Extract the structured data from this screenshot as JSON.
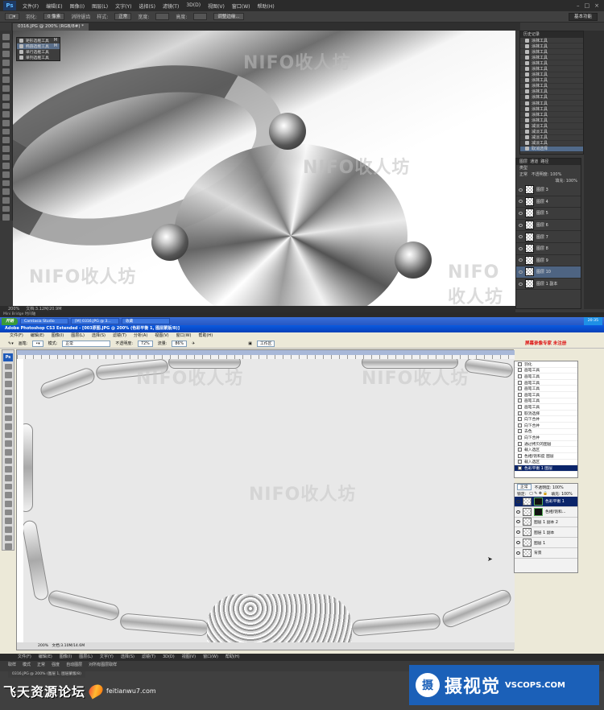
{
  "top": {
    "logo": "Ps",
    "menus": [
      "文件(F)",
      "编辑(E)",
      "图像(I)",
      "图层(L)",
      "文字(Y)",
      "选择(S)",
      "滤镜(T)",
      "3D(D)",
      "视图(V)",
      "窗口(W)",
      "帮助(H)"
    ],
    "options": {
      "feather_label": "羽化:",
      "feather_value": "0 像素",
      "antialias": "消除锯齿",
      "style_label": "样式:",
      "style_value": "正常",
      "width_label": "宽度:",
      "height_label": "高度:",
      "refine_edge": "调整边缘..."
    },
    "workspace": "基本功能",
    "doc_tab": "0316.JPG @ 200% (RGB/8#) *",
    "status": "200%",
    "doc_info": "文档:3.12M/20.9M",
    "mini_bridge": "Mini Bridge   时间轴",
    "history_title": "历史记录",
    "history": [
      {
        "label": "涂抹工具",
        "sel": false
      },
      {
        "label": "涂抹工具",
        "sel": false
      },
      {
        "label": "涂抹工具",
        "sel": false
      },
      {
        "label": "涂抹工具",
        "sel": false
      },
      {
        "label": "涂抹工具",
        "sel": false
      },
      {
        "label": "涂抹工具",
        "sel": false
      },
      {
        "label": "涂抹工具",
        "sel": false
      },
      {
        "label": "涂抹工具",
        "sel": false
      },
      {
        "label": "涂抹工具",
        "sel": false
      },
      {
        "label": "涂抹工具",
        "sel": false
      },
      {
        "label": "涂抹工具",
        "sel": false
      },
      {
        "label": "涂抹工具",
        "sel": false
      },
      {
        "label": "涂抹工具",
        "sel": false
      },
      {
        "label": "涂抹工具",
        "sel": false
      },
      {
        "label": "涂抹工具",
        "sel": false
      },
      {
        "label": "减淡工具",
        "sel": false
      },
      {
        "label": "减淡工具",
        "sel": false
      },
      {
        "label": "减淡工具",
        "sel": false
      },
      {
        "label": "减淡工具",
        "sel": false
      },
      {
        "label": "取消选择",
        "sel": true
      }
    ],
    "layers_tabs": [
      "图层",
      "通道",
      "路径"
    ],
    "layers_kind": "类型",
    "layers_mode": "正常",
    "layers_opacity": "不透明度: 100%",
    "layers_fill": "填充: 100%",
    "layers": [
      {
        "label": "图层 3",
        "sel": false
      },
      {
        "label": "图层 4",
        "sel": false
      },
      {
        "label": "图层 5",
        "sel": false
      },
      {
        "label": "图层 6",
        "sel": false
      },
      {
        "label": "图层 7",
        "sel": false
      },
      {
        "label": "图层 8",
        "sel": false
      },
      {
        "label": "图层 9",
        "sel": false
      },
      {
        "label": "图层 10",
        "sel": true
      },
      {
        "label": "图层 1 副本",
        "sel": false
      }
    ],
    "flyout": [
      {
        "label": "矩形选框工具",
        "key": "M",
        "sel": false
      },
      {
        "label": "椭圆选框工具",
        "key": "M",
        "sel": true
      },
      {
        "label": "单行选框工具",
        "key": "",
        "sel": false
      },
      {
        "label": "单列选框工具",
        "key": "",
        "sel": false
      }
    ]
  },
  "bottom": {
    "taskbar": {
      "start": "开始",
      "tasks": [
        "Camtasia Studio",
        "[M] 0316.JPG @ 3...",
        "收藏"
      ],
      "clock": "20:35"
    },
    "title": "Adobe Photoshop CS3 Extended - [003原图.JPG @ 200% (色彩平衡 1, 图层蒙版/8)]",
    "menus": [
      "文件(F)",
      "编辑(E)",
      "图像(I)",
      "图层(L)",
      "选择(S)",
      "滤镜(T)",
      "分析(A)",
      "视图(V)",
      "窗口(W)",
      "帮助(H)"
    ],
    "options": {
      "brush_label": "画笔:",
      "mode_label": "模式:",
      "mode_value": "正常",
      "opacity_label": "不透明度:",
      "opacity_value": "72%",
      "flow_label": "流量:",
      "flow_value": "86%",
      "workspace": "工作区"
    },
    "recorder": "屏幕录像专家 未注册",
    "doc_status": "文档:3.10M/14.6M",
    "zoom": "200%",
    "history": [
      {
        "label": "羽化",
        "sel": false
      },
      {
        "label": "画笔工具",
        "sel": false
      },
      {
        "label": "画笔工具",
        "sel": false
      },
      {
        "label": "画笔工具",
        "sel": false
      },
      {
        "label": "画笔工具",
        "sel": false
      },
      {
        "label": "画笔工具",
        "sel": false
      },
      {
        "label": "画笔工具",
        "sel": false
      },
      {
        "label": "画笔工具",
        "sel": false
      },
      {
        "label": "取消选择",
        "sel": false
      },
      {
        "label": "向下合并",
        "sel": false
      },
      {
        "label": "向下合并",
        "sel": false
      },
      {
        "label": "去色",
        "sel": false
      },
      {
        "label": "向下合并",
        "sel": false
      },
      {
        "label": "通过拷贝的图层",
        "sel": false
      },
      {
        "label": "载入选区",
        "sel": false
      },
      {
        "label": "色相/饱和度 图层",
        "sel": false
      },
      {
        "label": "载入选区",
        "sel": false
      },
      {
        "label": "色彩平衡 1 图层",
        "sel": true
      }
    ],
    "layers_mode": "正常",
    "layers_opacity": "不透明度: 100%",
    "layers_lock": "锁定:",
    "layers_fill": "填充: 100%",
    "layers": [
      {
        "label": "色彩平衡 1",
        "sel": true,
        "mask": true
      },
      {
        "label": "色相/饱和...",
        "sel": false,
        "mask": true
      },
      {
        "label": "图层 1 副本 2",
        "sel": false,
        "mask": false
      },
      {
        "label": "图层 1 副本",
        "sel": false,
        "mask": false
      },
      {
        "label": "图层 1",
        "sel": false,
        "mask": false
      },
      {
        "label": "背景",
        "sel": false,
        "mask": false
      }
    ]
  },
  "strip": {
    "menus": [
      "文件(F)",
      "编辑(E)",
      "图像(I)",
      "图层(L)",
      "文字(Y)",
      "选择(S)",
      "滤镜(T)",
      "3D(D)",
      "视图(V)",
      "窗口(W)",
      "帮助(H)"
    ],
    "opts": [
      "取样",
      "模式",
      "正常",
      "强度",
      "自动图层",
      "对所有图层取样"
    ],
    "tab": "0316.JPG @ 200% (图层 1, 图层蒙版/8)"
  },
  "watermarks": {
    "nifo": "NIFO收人坊"
  },
  "forum": {
    "name": "飞天资源论坛",
    "url": "feitianwu7.com"
  },
  "vscops": {
    "badge": "摄",
    "cn": "摄视觉",
    "en": "VSCOPS.COM"
  }
}
